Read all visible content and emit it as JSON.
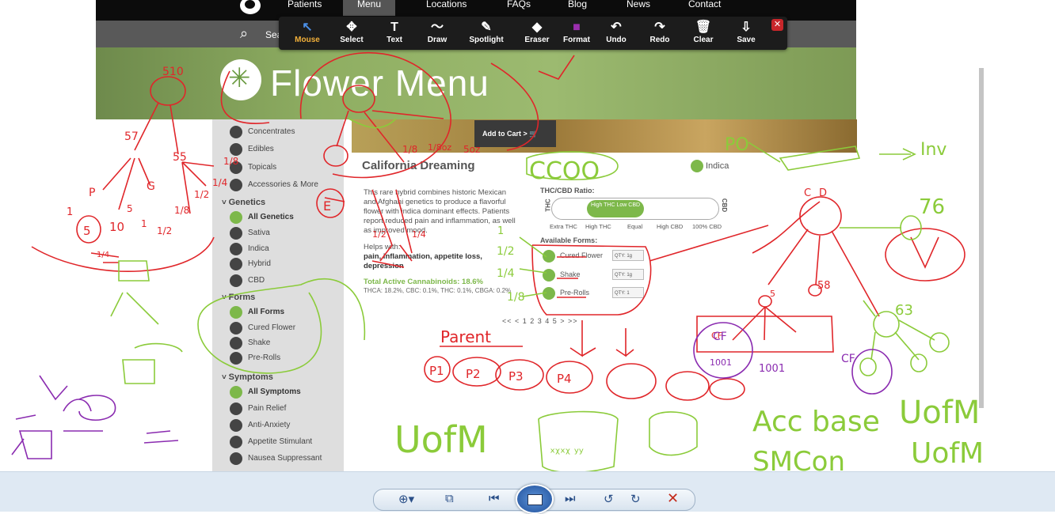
{
  "nav": {
    "items": [
      "Patients",
      "Menu",
      "Locations",
      "FAQs",
      "Blog",
      "News",
      "Contact"
    ],
    "active": "Menu",
    "search_text": "Sea"
  },
  "toolbar": {
    "tools": [
      {
        "label": "Mouse",
        "icon": "cursor-icon",
        "glyph": "↖"
      },
      {
        "label": "Select",
        "icon": "move-icon",
        "glyph": "✥"
      },
      {
        "label": "Text",
        "icon": "text-icon",
        "glyph": "T"
      },
      {
        "label": "Draw",
        "icon": "draw-icon",
        "glyph": "〜"
      },
      {
        "label": "Spotlight",
        "icon": "spotlight-icon",
        "glyph": "✎"
      },
      {
        "label": "Eraser",
        "icon": "eraser-icon",
        "glyph": "◆"
      },
      {
        "label": "Format",
        "icon": "format-swatch-icon",
        "glyph": "■"
      },
      {
        "label": "Undo",
        "icon": "undo-icon",
        "glyph": "↶"
      },
      {
        "label": "Redo",
        "icon": "redo-icon",
        "glyph": "↷"
      },
      {
        "label": "Clear",
        "icon": "trash-icon",
        "glyph": "🗑"
      },
      {
        "label": "Save",
        "icon": "save-icon",
        "glyph": "⇩"
      }
    ],
    "active": "Mouse",
    "close_glyph": "✕",
    "format_color": "#9b2fae"
  },
  "hero": {
    "title": "Flower Menu"
  },
  "sidebar": {
    "top_items": [
      {
        "label": "Concentrates",
        "icon": "concentrates-icon"
      },
      {
        "label": "Edibles",
        "icon": "edibles-icon"
      },
      {
        "label": "Topicals",
        "icon": "topicals-icon"
      },
      {
        "label": "Accessories & More",
        "icon": "accessories-icon"
      }
    ],
    "genetics": {
      "heading": "Genetics",
      "items": [
        "All Genetics",
        "Sativa",
        "Indica",
        "Hybrid",
        "CBD"
      ]
    },
    "forms": {
      "heading": "Forms",
      "items": [
        "All Forms",
        "Cured Flower",
        "Shake",
        "Pre-Rolls"
      ]
    },
    "symptoms": {
      "heading": "Symptoms",
      "items": [
        "All Symptoms",
        "Pain Relief",
        "Anti-Anxiety",
        "Appetite Stimulant",
        "Nausea Suppressant"
      ]
    }
  },
  "product": {
    "title": "California Dreaming",
    "genetic": "Indica",
    "description": "This rare hybrid combines historic Mexican and Afghani genetics to produce a flavorful flower with indica dominant effects. Patients report reduced pain and inflammation, as well as improved mood.",
    "helps_label": "Helps with:",
    "helps_value": "pain, inflammation, appetite loss, depression",
    "cannabinoids_label": "Total Active Cannabinoids: 18.6%",
    "cannabinoids_detail": "THCA: 18.2%, CBC: 0.1%, THC: 0.1%, CBGA: 0.2%",
    "ratio_title": "THC/CBD Ratio:",
    "ratio_thc": "THC",
    "ratio_cbd": "CBD",
    "ratio_knob": "High THC Low CBD",
    "ratio_labels": [
      "Extra THC",
      "High THC",
      "Equal",
      "High CBD",
      "100% CBD"
    ],
    "forms_title": "Available Forms:",
    "forms": [
      {
        "name": "Cured Flower",
        "qty": "QTY: 1g"
      },
      {
        "name": "Shake",
        "qty": "QTY: 1g"
      },
      {
        "name": "Pre-Rolls",
        "qty": "QTY: 1"
      }
    ],
    "add_to_cart": "Add to Cart >",
    "pager": "<< < 1 2 3 4 5 > >>"
  },
  "annotations": {
    "red": [
      "510",
      "57",
      "55",
      "1/8",
      "1/4",
      "1/2",
      "1/8",
      "1/2",
      "P",
      "G",
      "1",
      "10",
      "5",
      "1",
      "5",
      "1/4",
      "5oz",
      "E",
      "1/8",
      "1/8oz",
      "1/2",
      "1/4",
      "C",
      "D",
      "58",
      "5",
      "CF",
      "Parent",
      "P1",
      "P2",
      "P3",
      "P4"
    ],
    "green": [
      "PO",
      "Inv",
      "76",
      "63",
      "1/2",
      "1/4",
      "1/8",
      "UofM",
      "Acc base",
      "UofM",
      "SMCon",
      "UofM",
      "Mul",
      "1",
      "CCOO",
      "ˣᵡˣᵡ ʸʸ"
    ],
    "purple": [
      "CF",
      "1001",
      "1001",
      "CF"
    ]
  },
  "viewer": {
    "buttons": [
      "zoom-icon",
      "fit-icon",
      "prev-icon",
      "slideshow-icon",
      "next-icon",
      "rotate-left-icon",
      "rotate-right-icon",
      "delete-icon"
    ]
  }
}
